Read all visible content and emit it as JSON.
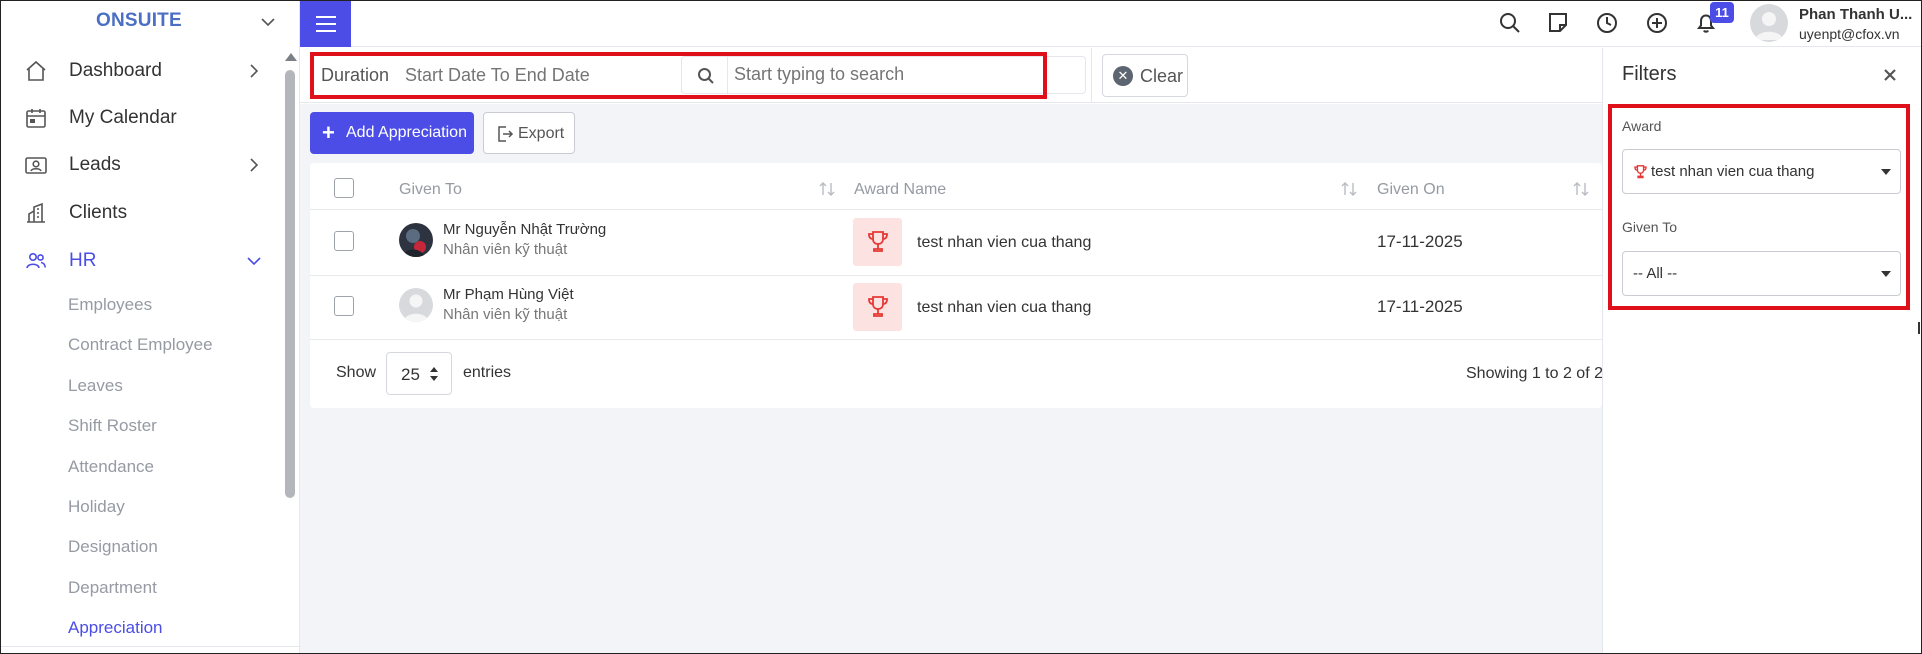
{
  "brand": {
    "name": "ONSUITE"
  },
  "sidebar": {
    "items": [
      {
        "label": "Dashboard",
        "icon": "home-icon",
        "has_arrow": true
      },
      {
        "label": "My Calendar",
        "icon": "calendar-icon",
        "has_arrow": false
      },
      {
        "label": "Leads",
        "icon": "id-card-icon",
        "has_arrow": true
      },
      {
        "label": "Clients",
        "icon": "building-icon",
        "has_arrow": false
      },
      {
        "label": "HR",
        "icon": "users-icon",
        "has_arrow": true,
        "expanded": true
      }
    ],
    "hr_subitems": [
      "Employees",
      "Contract Employee",
      "Leaves",
      "Shift Roster",
      "Attendance",
      "Holiday",
      "Designation",
      "Department",
      "Appreciation"
    ],
    "active_subitem": "Appreciation"
  },
  "topbar": {
    "icons": [
      "search-icon",
      "sticky-note-icon",
      "clock-icon",
      "plus-circle-icon",
      "bell-icon"
    ],
    "notification_count": "11",
    "user": {
      "name": "Phan Thanh U...",
      "email": "uyenpt@cfox.vn"
    }
  },
  "filter_bar": {
    "duration_label": "Duration",
    "duration_placeholder": "Start Date To End Date",
    "search_placeholder": "Start typing to search",
    "clear_label": "Clear"
  },
  "actions": {
    "add_label": "Add Appreciation",
    "export_label": "Export"
  },
  "table": {
    "columns": [
      "Given To",
      "Award Name",
      "Given On"
    ],
    "rows": [
      {
        "name": "Mr Nguyễn Nhật Trường",
        "role": "Nhân viên kỹ thuật",
        "award": "test nhan vien cua thang",
        "date": "17-11-2025"
      },
      {
        "name": "Mr Phạm Hùng Việt",
        "role": "Nhân viên kỹ thuật",
        "award": "test nhan vien cua thang",
        "date": "17-11-2025"
      }
    ],
    "footer": {
      "show_label": "Show",
      "entries_value": "25",
      "entries_label": "entries",
      "showing_text": "Showing 1 to 2 of 2"
    }
  },
  "filters_panel": {
    "title": "Filters",
    "award_label": "Award",
    "award_value": "test nhan vien cua thang",
    "given_to_label": "Given To",
    "given_to_value": "-- All --"
  },
  "colors": {
    "accent": "#4b4de6",
    "brand": "#4a6fc4",
    "highlight": "#e0101a",
    "trophy": "#e53935"
  }
}
